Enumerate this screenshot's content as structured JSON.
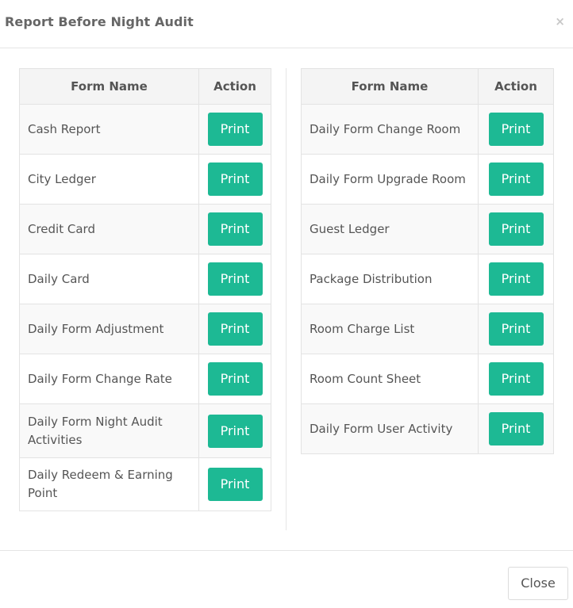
{
  "modal": {
    "title": "Report Before Night Audit",
    "close_symbol": "×",
    "close_button_label": "Close"
  },
  "columns": {
    "form_name": "Form Name",
    "action": "Action"
  },
  "print_label": "Print",
  "left_forms": [
    "Cash Report",
    "City Ledger",
    "Credit Card",
    "Daily Card",
    "Daily Form Adjustment",
    "Daily Form Change Rate",
    "Daily Form Night Audit Activities",
    "Daily Redeem & Earning Point"
  ],
  "right_forms": [
    "Daily Form Change Room",
    "Daily Form Upgrade Room",
    "Guest Ledger",
    "Package Distribution",
    "Room Charge List",
    "Room Count Sheet",
    "Daily Form User Activity"
  ],
  "colors": {
    "accent": "#1db994"
  }
}
